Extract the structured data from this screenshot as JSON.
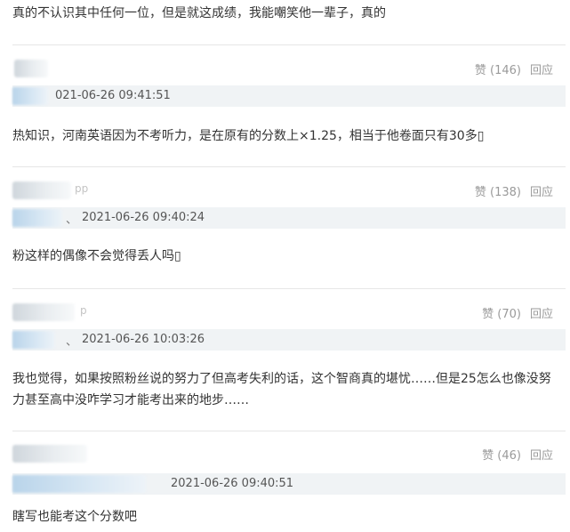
{
  "comments": [
    {
      "text": "真的不认识其中任何一位，但是就这成绩，我能嘲笑他一辈子，真的",
      "user_suffix": "",
      "like_label": "赞",
      "like_count": "(146)",
      "reply_label": "回应",
      "time_prefix": "",
      "time": "021-06-26 09:41:51"
    },
    {
      "text": "热知识，河南英语因为不考听力，是在原有的分数上×1.25，相当于他卷面只有30多▯",
      "user_suffix": "pp",
      "like_label": "赞",
      "like_count": "(138)",
      "reply_label": "回应",
      "time_prefix": "、",
      "time": "2021-06-26 09:40:24"
    },
    {
      "text": "粉这样的偶像不会觉得丢人吗▯",
      "user_suffix": "p",
      "like_label": "赞",
      "like_count": "(70)",
      "reply_label": "回应",
      "time_prefix": "、",
      "time": "2021-06-26 10:03:26"
    },
    {
      "text": "我也觉得，如果按照粉丝说的努力了但高考失利的话，这个智商真的堪忧……但是25怎么也像没努力甚至高中没咋学习才能考出来的地步……",
      "user_suffix": "",
      "like_label": "赞",
      "like_count": "(46)",
      "reply_label": "回应",
      "time_prefix": "",
      "time": "2021-06-26 09:40:51"
    }
  ],
  "last_comment": {
    "text": "瞎写也能考这个分数吧"
  }
}
